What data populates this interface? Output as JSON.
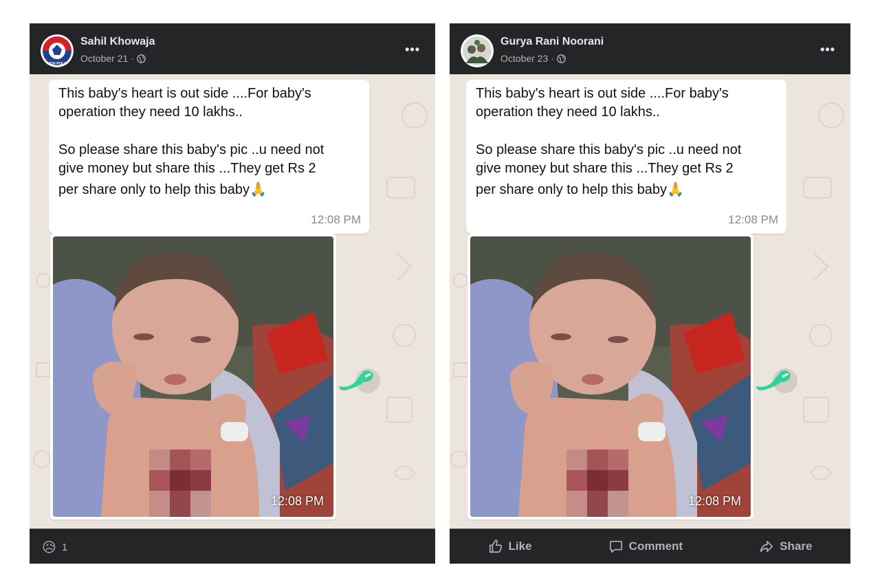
{
  "posts": [
    {
      "author": "Sahil Khowaja",
      "date": "October 21",
      "separator": "·",
      "avatar_text": "SINDH POLICE",
      "more_label": "•••",
      "message": {
        "lines": [
          "This  baby's heart is out side ....For baby's",
          "operation  they need 10 lakhs..",
          "So please share this baby's pic ..u need not",
          "give money  but share this ...They get Rs 2",
          "per share only to help this  baby"
        ],
        "emoji": "🙏",
        "time": "12:08 PM"
      },
      "photo": {
        "time": "12:08 PM"
      },
      "reaction": {
        "emoji": "😥",
        "count": "1"
      }
    },
    {
      "author": "Gurya Rani Noorani",
      "date": "October 23",
      "separator": "·",
      "more_label": "•••",
      "message": {
        "lines": [
          "This  baby's heart is out side ....For baby's",
          "operation  they need 10 lakhs..",
          "So please share this baby's pic ..u need not",
          "give money  but share this ...They get Rs 2",
          "per share only to help this  baby"
        ],
        "emoji": "🙏",
        "time": "12:08 PM"
      },
      "photo": {
        "time": "12:08 PM"
      },
      "actions": {
        "like": "Like",
        "comment": "Comment",
        "share": "Share"
      }
    }
  ],
  "colors": {
    "post_bg": "#242526",
    "chat_bg": "#ece5dd",
    "primary_text": "#e4e6eb",
    "secondary_text": "#b0b3b8",
    "forward_icon": "#2fd39b"
  },
  "icons": [
    "globe-icon",
    "more-icon",
    "forward-icon",
    "like-icon",
    "comment-icon",
    "share-icon",
    "sad-reaction-icon"
  ]
}
